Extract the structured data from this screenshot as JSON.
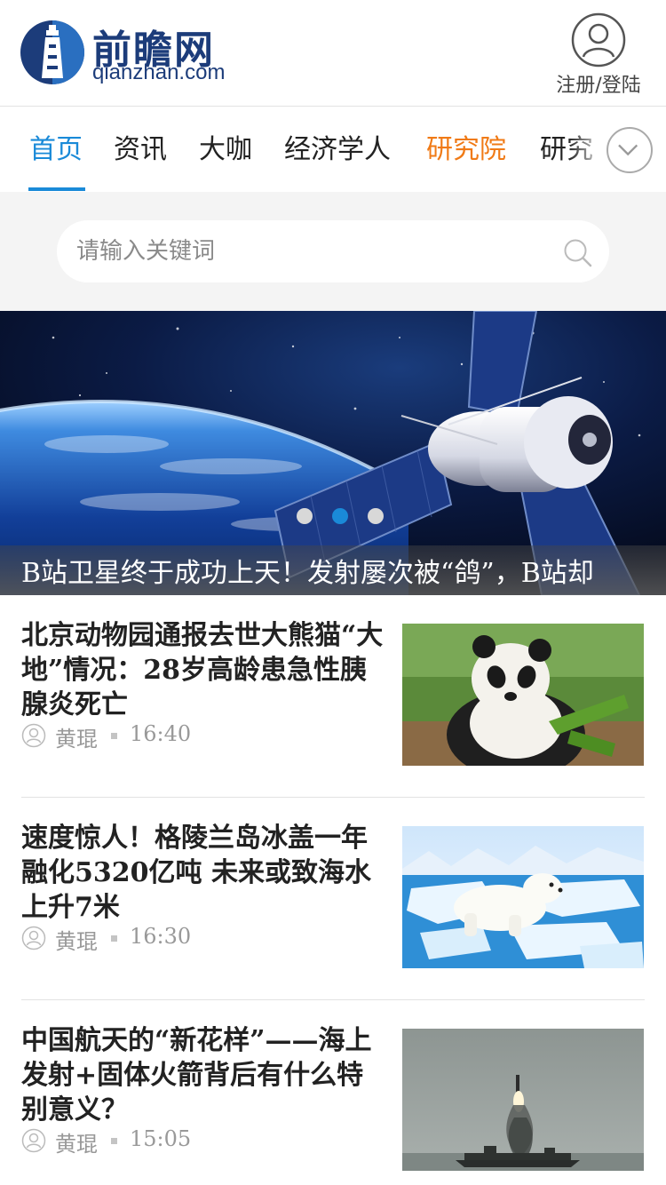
{
  "header": {
    "logo_cn": "前瞻网",
    "logo_en": "qianzhan",
    "logo_domain": ".com",
    "user_label": "注册/登陆"
  },
  "nav": {
    "items": [
      "首页",
      "资讯",
      "大咖",
      "经济学人",
      "研究院",
      "研究"
    ],
    "active_index": 0,
    "accent_index": 4
  },
  "search": {
    "placeholder": "请输入关键词"
  },
  "banner": {
    "caption": "B站卫星终于成功上天！发射屡次被“鸽”，B站却",
    "slide_count": 3,
    "active_slide": 1
  },
  "articles": [
    {
      "title": "北京动物园通报去世大熊猫“大地”情况：28岁高龄患急性胰腺炎死亡",
      "author": "黄琨",
      "time": "16:40",
      "thumb": "panda"
    },
    {
      "title": "速度惊人！格陵兰岛冰盖一年融化5320亿吨 未来或致海水上升7米",
      "author": "黄琨",
      "time": "16:30",
      "thumb": "polar-bear"
    },
    {
      "title": "中国航天的“新花样”——海上发射+固体火箭背后有什么特别意义？",
      "author": "黄琨",
      "time": "15:05",
      "thumb": "rocket-launch"
    }
  ],
  "colors": {
    "brand": "#1c3c7a",
    "active_tab": "#1a8ad8",
    "accent_tab": "#f07a16",
    "meta_gray": "#999999"
  },
  "icons": [
    "user-icon",
    "chevron-down-icon",
    "search-icon",
    "avatar-icon"
  ]
}
